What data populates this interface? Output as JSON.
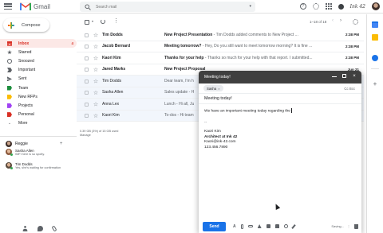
{
  "app": {
    "product_name": "Gmail",
    "brand": "Ink 42"
  },
  "search": {
    "placeholder": "Search mail"
  },
  "sidebar": {
    "compose_label": "Compose",
    "items": [
      {
        "label": "Inbox",
        "count": "4",
        "icon": "inbox-icon",
        "active": true
      },
      {
        "label": "Starred",
        "icon": "star-icon"
      },
      {
        "label": "Snoozed",
        "icon": "clock-icon"
      },
      {
        "label": "Important",
        "icon": "important-icon"
      },
      {
        "label": "Sent",
        "icon": "send-icon"
      },
      {
        "label": "Team",
        "icon": "label-icon",
        "color": "#1e8e3e"
      },
      {
        "label": "New RFPs",
        "icon": "label-icon",
        "color": "#fbbc04"
      },
      {
        "label": "Projects",
        "icon": "label-icon",
        "color": "#a142f4"
      },
      {
        "label": "Personal",
        "icon": "label-icon",
        "color": "#d93025"
      },
      {
        "label": "More",
        "icon": "chevron-down-icon"
      }
    ]
  },
  "hangouts": {
    "user": "Reggie",
    "contacts": [
      {
        "name": "Sasha Allen",
        "status": "WiFi here is so spotty."
      },
      {
        "name": "Tim Dodds",
        "status": "Yes, she's waiting for confirmation"
      }
    ]
  },
  "toolbar": {
    "range": "1–18 of 18"
  },
  "emails": [
    {
      "sender": "Tim Dodds",
      "subject": "New Project Presentation",
      "snippet": " - Tim Dodds added comments to New Project ...",
      "date": "2:38 PM",
      "unread": true
    },
    {
      "sender": "Jacob Bernard",
      "subject": "Meeting tomorrow?",
      "snippet": " - Hey, Do you still want to meet tomorrow morning? It is fine ...",
      "date": "2:38 PM",
      "unread": true
    },
    {
      "sender": "Kaori Kim",
      "subject": "Thanks for your help",
      "snippet": " - Thanks so much for your help with that report. I submitted...",
      "date": "2:38 PM",
      "unread": true
    },
    {
      "sender": "Jared Marks",
      "subject": "New Project Proposal",
      "snippet": "",
      "date": "Jun 21",
      "unread": true
    },
    {
      "sender": "Tim Dodds",
      "subject": "",
      "snippet": "Dear team, I'm h",
      "date": "Jun 8",
      "unread": false
    },
    {
      "sender": "Sasha Allen",
      "subject": "",
      "snippet": "Sales update - H",
      "date": "May 8",
      "unread": false
    },
    {
      "sender": "Anna Lex",
      "subject": "",
      "snippet": "Lunch - Hi all, Ju",
      "date": "May 3",
      "unread": false
    },
    {
      "sender": "Kaori Kim",
      "subject": "",
      "snippet": "To-dos - Hi team",
      "date": "May 1",
      "unread": false
    }
  ],
  "storage": {
    "used": "0.39 GB (3%) of 15 GB used",
    "manage": "Manage"
  },
  "compose_window": {
    "title": "Meeting today!",
    "to_chip": "Sasha",
    "cc_bcc": "Cc Bcc",
    "subject": "Meeting today!",
    "body": "We have an important meeting today regarding the",
    "signature_sep": "--",
    "sig_name": "Kaori Kim",
    "sig_title": "Architect at Ink 42",
    "sig_email": "Kaori@ink-42.com",
    "sig_phone": "123.456.7890",
    "send_label": "Send",
    "status": "Saving..."
  },
  "colors": {
    "accent": "#1a73e8",
    "inbox_active": "#d93025",
    "compose_header": "#404040"
  }
}
